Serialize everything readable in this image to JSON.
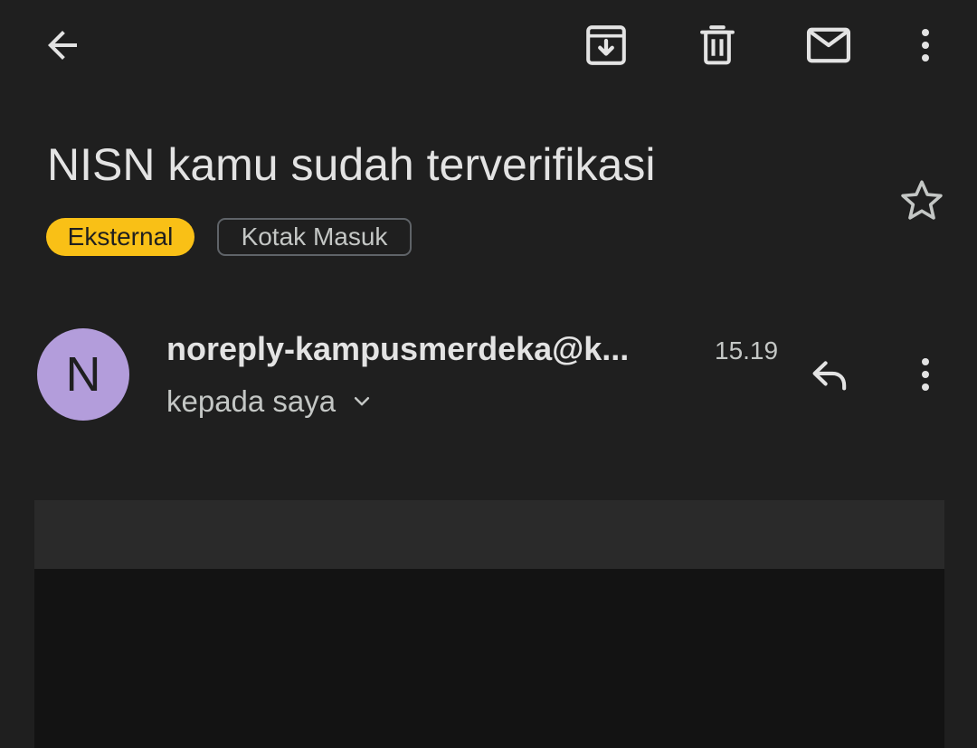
{
  "toolbar": {
    "back": "arrow-back-icon",
    "archive": "archive-icon",
    "delete": "trash-icon",
    "mark_unread": "mail-icon",
    "more": "more-vert-icon"
  },
  "email": {
    "subject": "NISN kamu sudah terverifikasi",
    "labels": {
      "external": "Eksternal",
      "inbox": "Kotak Masuk"
    },
    "sender": {
      "initial": "N",
      "address": "noreply-kampusmerdeka@k...",
      "time": "15.19",
      "recipient": "kepada saya"
    }
  },
  "colors": {
    "background": "#1f1f1f",
    "text": "#e3e3e3",
    "muted_text": "#c4c7c5",
    "external_chip": "#f9c016",
    "avatar": "#b39ddb"
  }
}
